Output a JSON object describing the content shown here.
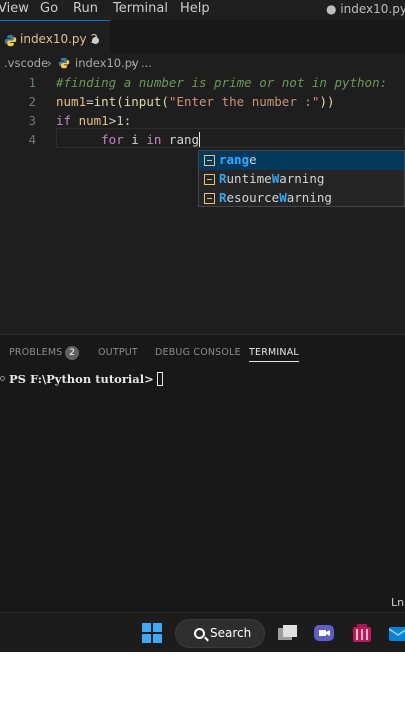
{
  "menubar": {
    "items": [
      "View",
      "Go",
      "Run",
      "Terminal",
      "Help"
    ],
    "window_title": "● index10.py -"
  },
  "tab": {
    "name": "index10.py 2",
    "modified": true
  },
  "breadcrumb": {
    "folder": ".vscode",
    "file": "index10.py",
    "more": "..."
  },
  "editor": {
    "lines": [
      {
        "number": "1",
        "comment": "#finding a number is prime or not in python:"
      },
      {
        "number": "2",
        "var": "num1",
        "op": "=",
        "fn1": "int",
        "p1": "(",
        "fn2": "input",
        "p2": "(",
        "str": "\"Enter the number :\"",
        "p3": "))"
      },
      {
        "number": "3",
        "kw": "if",
        "var": "num1",
        "op": ">",
        "num": "1",
        "colon": ":"
      },
      {
        "number": "4",
        "kw1": "for",
        "var": "i",
        "kw2": "in",
        "partial": "rang"
      }
    ]
  },
  "suggestions": [
    {
      "match": "rang",
      "rest": "e",
      "selected": true
    },
    {
      "pre": "",
      "match": "R",
      "mid": "untime",
      "match2": "W",
      "rest": "arning",
      "selected": false
    },
    {
      "pre": "",
      "match": "R",
      "mid": "esource",
      "match2": "W",
      "rest": "arning",
      "selected": false
    }
  ],
  "panel": {
    "tabs": [
      "PROBLEMS",
      "OUTPUT",
      "DEBUG CONSOLE",
      "TERMINAL"
    ],
    "active_tab": "TERMINAL",
    "problems_count": "2",
    "terminal_prompt": "PS F:\\Python tutorial>"
  },
  "statusbar": {
    "position_label": "Ln"
  },
  "taskbar": {
    "search_label": "Search"
  },
  "colors": {
    "editor_bg": "#1e1e1e",
    "accent": "#0078d4",
    "modified_file": "#e2c08d",
    "suggest_selected": "#04395e"
  }
}
